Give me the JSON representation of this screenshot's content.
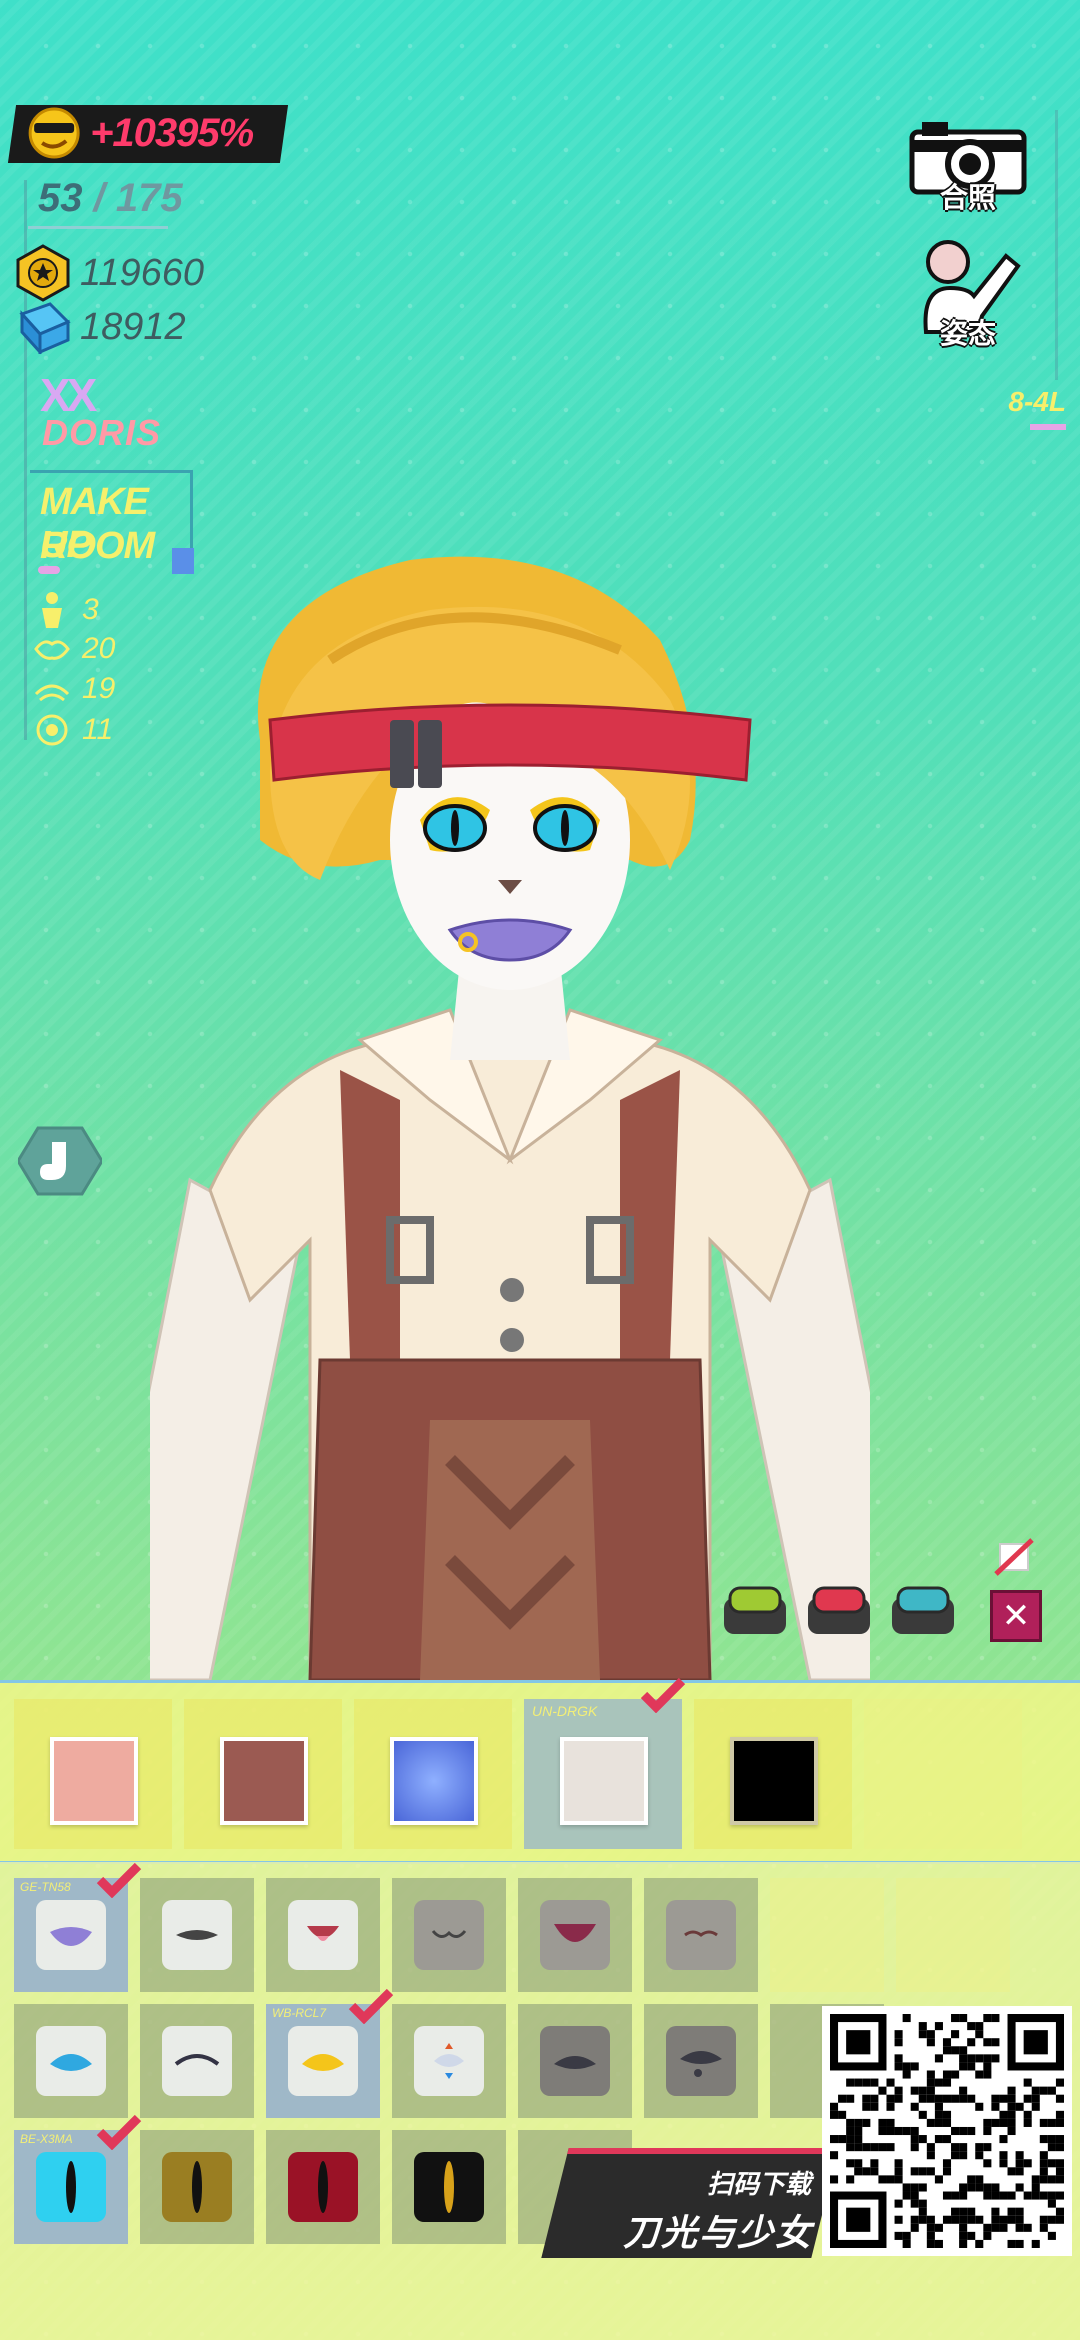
{
  "hud": {
    "bonus": "+10395%",
    "count_current": "53",
    "count_sep": " / ",
    "count_max": "175",
    "coins": "119660",
    "gems": "18912",
    "marks": "XX",
    "character_name": "DORIS",
    "room_line1": "MAKE UP",
    "room_line2": "ROOM",
    "stats": [
      {
        "icon": "body-icon",
        "value": "3"
      },
      {
        "icon": "lips-icon",
        "value": "20"
      },
      {
        "icon": "eye-icon",
        "value": "19"
      },
      {
        "icon": "pupil-icon",
        "value": "11"
      }
    ]
  },
  "right_hud": {
    "photo_label": "合照",
    "pose_label": "姿态",
    "stage": "8-4L"
  },
  "colors": {
    "swatches": [
      {
        "color": "#eeaba0",
        "selected": false,
        "code": ""
      },
      {
        "color": "#9b5a52",
        "selected": false,
        "code": ""
      },
      {
        "color": "#5c7ae0",
        "selected": false,
        "code": ""
      },
      {
        "color": "#e8e2dc",
        "selected": true,
        "code": "UN-DRGK"
      },
      {
        "color": "#000000",
        "selected": false,
        "code": ""
      }
    ]
  },
  "parts": {
    "mouth_codes": [
      "GE-TN58"
    ],
    "eye_code": "WB-RCL7",
    "pupil_code": "BE-X3MA"
  },
  "promo": {
    "line1": "扫码下载",
    "line2": "刀光与少女"
  },
  "accent": {
    "close": "#b0205a",
    "check": "#e0385a"
  }
}
